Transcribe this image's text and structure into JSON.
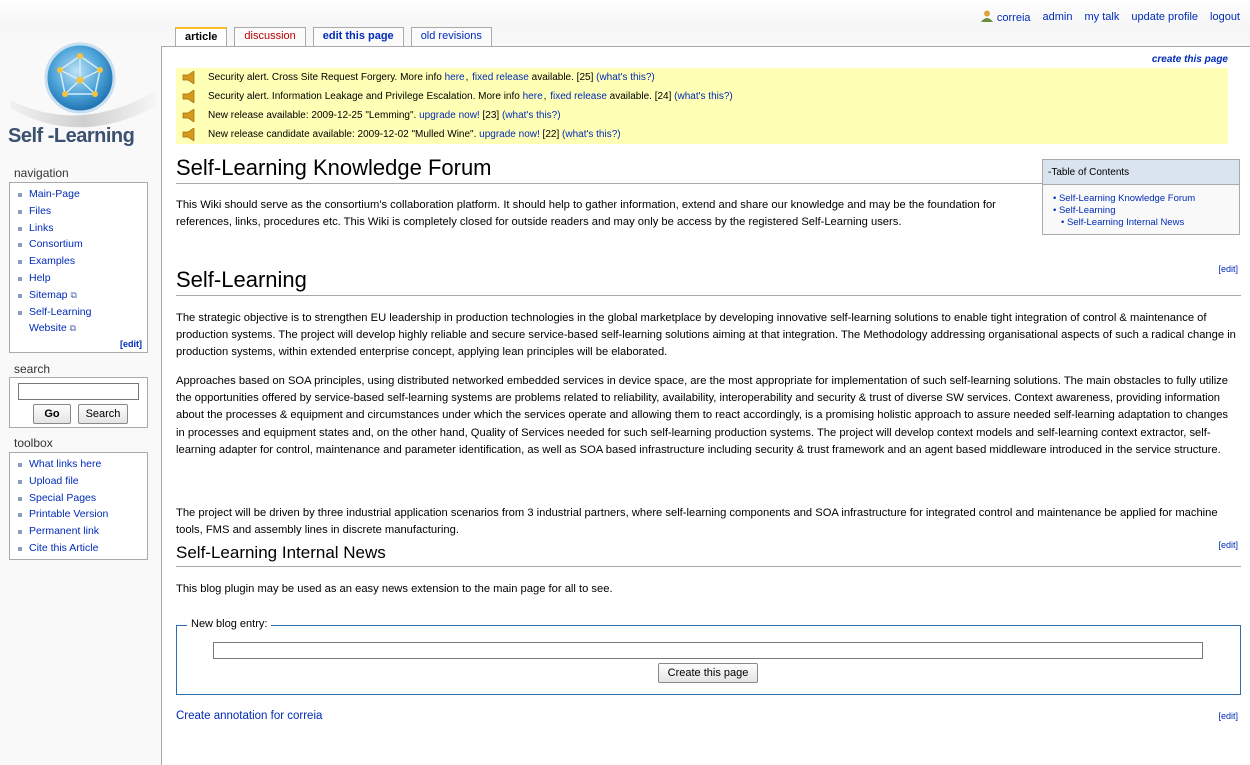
{
  "personal": {
    "user": "correia",
    "links": [
      "admin",
      "my talk",
      "update profile",
      "logout"
    ]
  },
  "tabs": {
    "article": "article",
    "discussion": "discussion",
    "edit": "edit this page",
    "revisions": "old revisions"
  },
  "logo": {
    "text": "Self -Learning"
  },
  "navigation": {
    "title": "navigation",
    "items": [
      "Main-Page",
      "Files",
      "Links",
      "Consortium",
      "Examples",
      "Help",
      "Sitemap",
      "Self-Learning",
      "Website"
    ],
    "edit": "[edit]"
  },
  "search": {
    "title": "search",
    "go": "Go",
    "search": "Search"
  },
  "toolbox": {
    "title": "toolbox",
    "items": [
      "What links here",
      "Upload file",
      "Special Pages",
      "Printable Version",
      "Permanent link",
      "Cite this Article"
    ]
  },
  "content": {
    "create_page": "create this page",
    "alerts": [
      {
        "pre": "Security alert. Cross Site Request Forgery. More info ",
        "link1": "here",
        "link2": "fixed release",
        "post": " available. [25] ",
        "what": "(what's this?)"
      },
      {
        "pre": "Security alert. Information Leakage and Privilege Escalation. More info ",
        "link1": "here",
        "link2": "fixed release",
        "post": " available. [24] ",
        "what": "(what's this?)"
      },
      {
        "pre": "New release available: 2009-12-25 \"Lemming\". ",
        "link1": "upgrade now!",
        "post": " [23] ",
        "what": "(what's this?)"
      },
      {
        "pre": "New release candidate available: 2009-12-02 \"Mulled Wine\". ",
        "link1": "upgrade now!",
        "post": " [22] ",
        "what": "(what's this?)"
      }
    ],
    "h1": "Self-Learning Knowledge Forum",
    "intro": "This Wiki should serve as the consortium's collaboration platform. It should help to gather information, extend and share our knowledge and may be the foundation for references, links, procedures etc. This Wiki is completely closed for outside readers and may only be access by the registered Self-Learning users.",
    "toc": {
      "title": "-Table of Contents",
      "items": [
        "Self-Learning Knowledge Forum",
        "Self-Learning",
        "Self-Learning Internal News"
      ]
    },
    "edit": "[edit]",
    "h2": "Self-Learning",
    "p1": "The strategic objective is to strengthen EU leadership in production technologies in the global marketplace by developing innovative self-learning solutions to enable tight integration of control & maintenance of production systems. The project will develop highly reliable and secure service-based self-learning solutions aiming at that integration. The Methodology addressing organisational aspects of such a radical change in production systems, within extended enterprise concept, applying lean principles will be elaborated.",
    "p2": "Approaches based on SOA principles, using distributed networked embedded services in device space, are the most appropriate for implementation of such self-learning solutions. The main obstacles to fully utilize the opportunities offered by service-based self-learning systems are problems related to reliability, availability, interoperability and security & trust of diverse SW services. Context awareness, providing information about the processes & equipment and circumstances under which the services operate and allowing them to react accordingly, is a promising holistic approach to assure needed self-learning adaptation to changes in processes and equipment states and, on the other hand, Quality of Services needed for such self-learning production systems. The project will develop context models and self-learning context extractor, self-learning adapter for control, maintenance and parameter identification, as well as SOA based infrastructure including security & trust framework and an agent based middleware introduced in the service structure.",
    "p3": "The project will be driven by three industrial application scenarios from 3 industrial partners, where self-learning components and SOA infrastructure for integrated control and maintenance be applied for machine tools, FMS and assembly lines in discrete manufacturing.",
    "h3": "Self-Learning Internal News",
    "p4": "This blog plugin may be used as an easy news extension to the main page for all to see.",
    "blog": {
      "legend": "New blog entry:",
      "button": "Create this page"
    },
    "annotation": "Create annotation for correia"
  }
}
